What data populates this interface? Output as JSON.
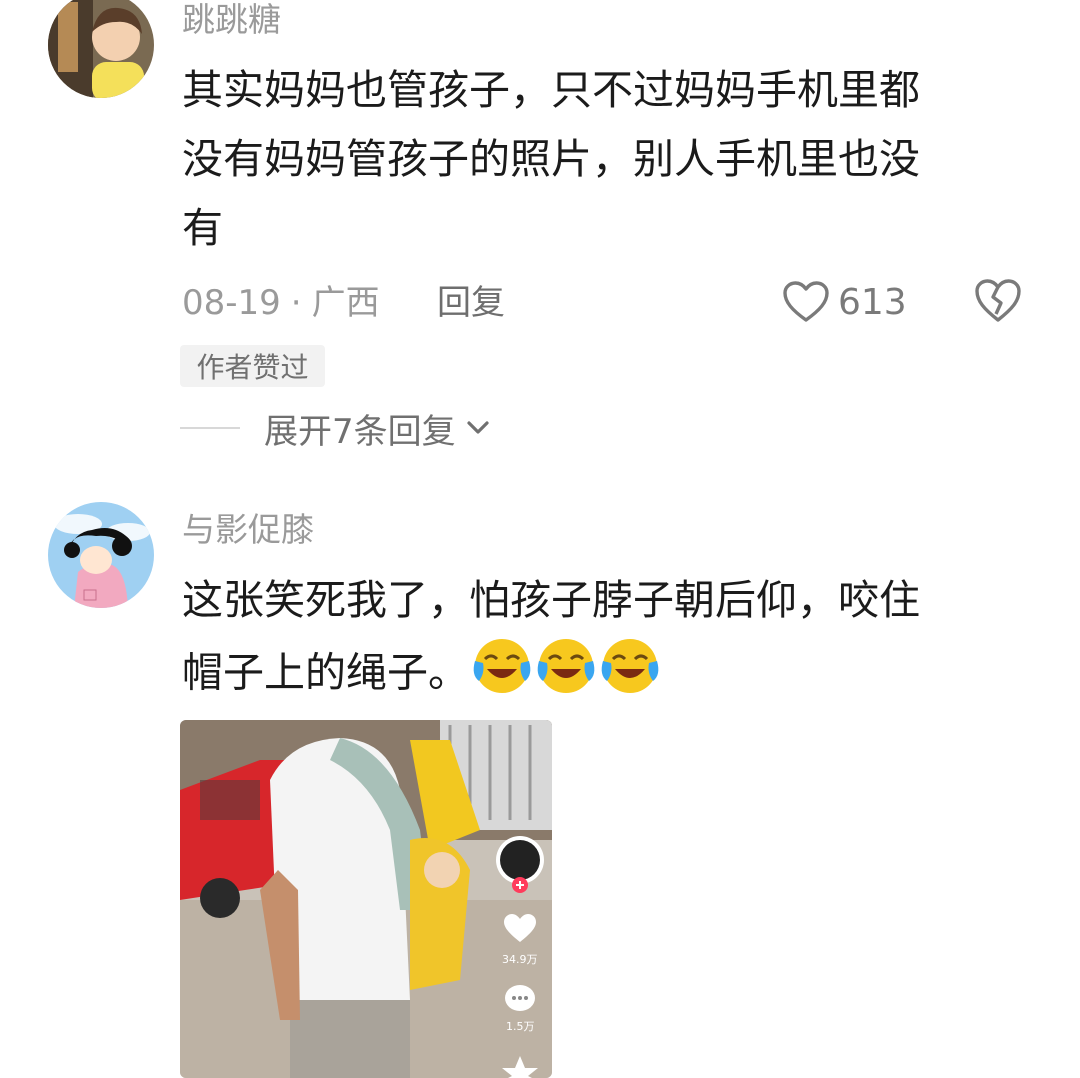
{
  "comments": [
    {
      "username": "跳跳糖",
      "lines": [
        "其实妈妈也管孩子，只不过妈妈手机里都",
        "没有妈妈管孩子的照片，别人手机里也没",
        "有"
      ],
      "date": "08-19",
      "separator": "·",
      "location": "广西",
      "reply_label": "回复",
      "like_count": "613",
      "badge": "作者赞过",
      "expand_label": "展开7条回复"
    },
    {
      "username": "与影促膝",
      "lines": [
        "这张笑死我了，怕孩子脖子朝后仰，咬住",
        "帽子上的绳子。"
      ],
      "emoji_count": 3,
      "image_overlay": {
        "likes": "34.9万",
        "comments": "1.5万"
      }
    }
  ],
  "colors": {
    "text_primary": "#1b1b1b",
    "text_secondary": "#9a9a9a",
    "badge_bg": "#f2f2f2"
  },
  "icons": [
    "heart-outline-icon",
    "broken-heart-icon",
    "chevron-down-icon",
    "crying-laughing-emoji",
    "plus-icon",
    "comment-bubble-icon",
    "star-icon"
  ]
}
